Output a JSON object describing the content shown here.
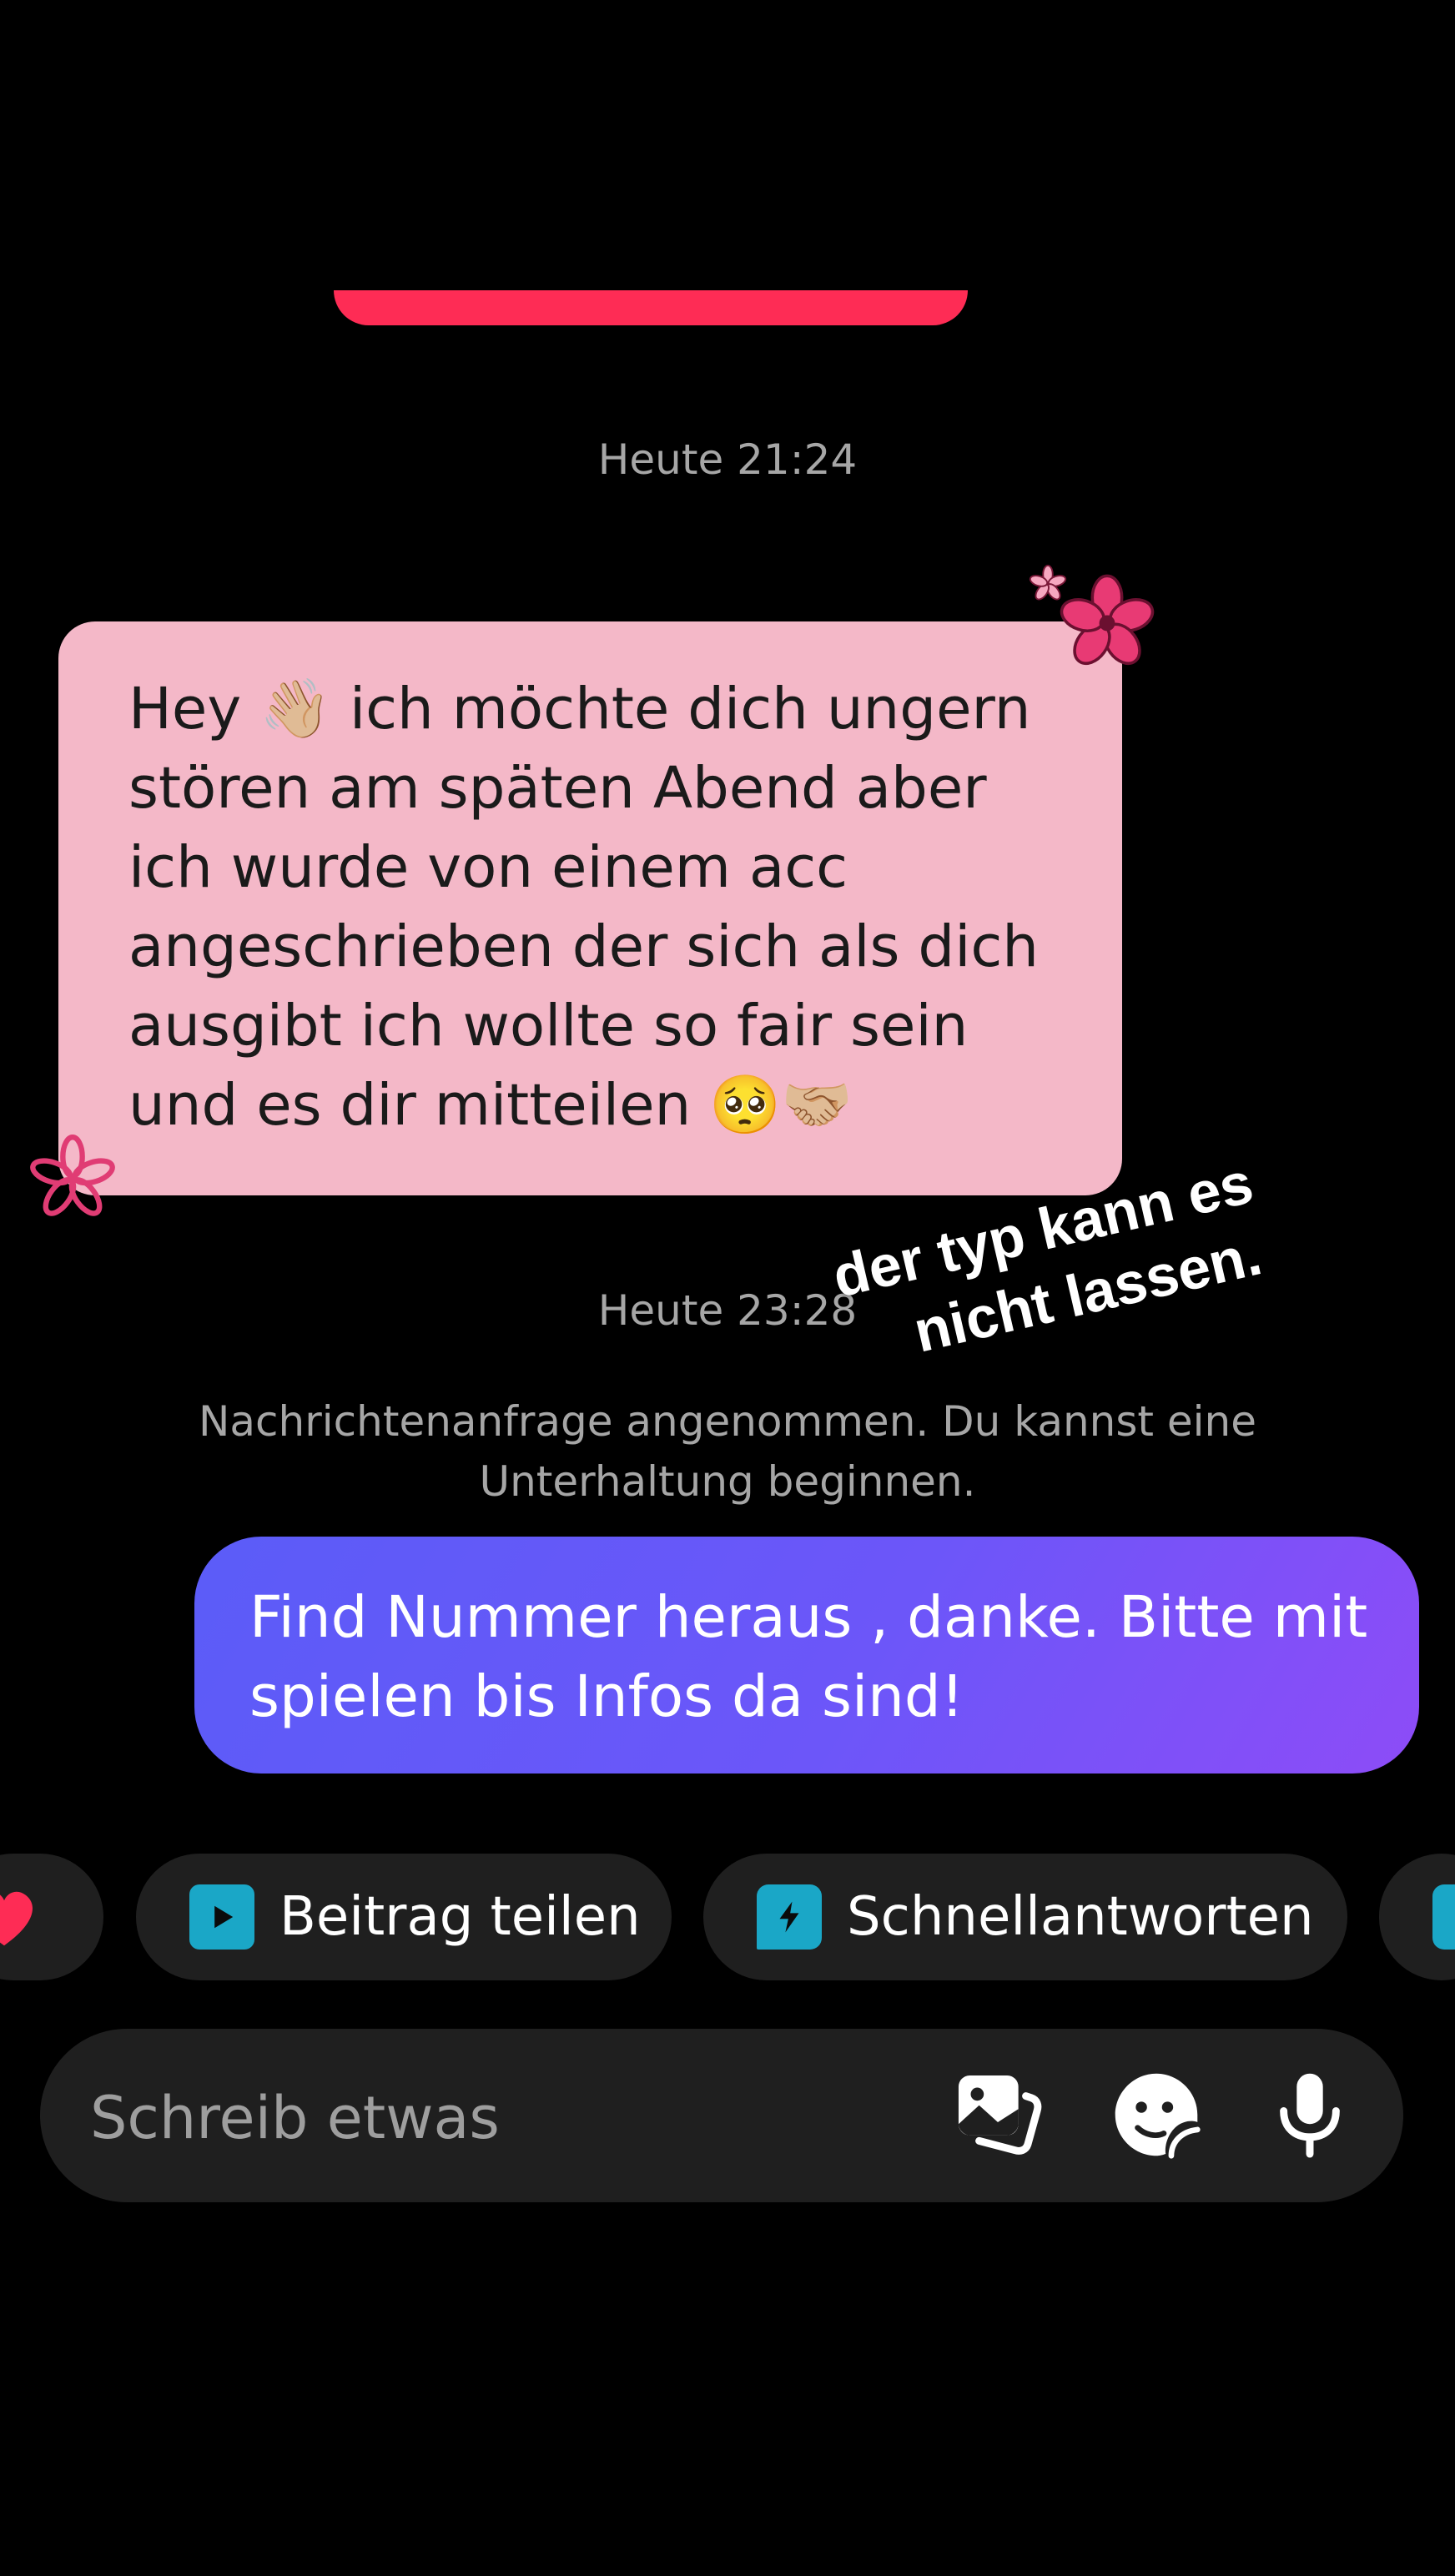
{
  "conversation": {
    "timestamp_1": "Heute 21:24",
    "incoming_message": {
      "lines": [
        "Hey 👋🏼 ich möchte dich ungern",
        "stören am späten Abend aber",
        "ich wurde von einem acc",
        "angeschrieben der sich als dich",
        "ausgibt ich wollte so fair sein",
        "und es dir mitteilen 🥺🤝🏼"
      ]
    },
    "timestamp_2": "Heute 23:28",
    "request_notice": {
      "line1": "Nachrichtenanfrage angenommen. Du kannst eine",
      "line2": "Unterhaltung beginnen."
    },
    "outgoing_message": {
      "lines": [
        "Find Nummer heraus , danke. Bitte mit",
        "spielen bis Infos da sind!"
      ]
    }
  },
  "overlay_caption": {
    "line1": "der typ kann es",
    "line2": "nicht lassen."
  },
  "quick_actions": [
    {
      "label": "",
      "icon": "heart-icon"
    },
    {
      "label": "Beitrag teilen",
      "icon": "play-video-icon"
    },
    {
      "label": "Schnellantworten",
      "icon": "lightning-chat-icon"
    },
    {
      "label": "",
      "icon": "chat-icon"
    }
  ],
  "composer": {
    "placeholder": "Schreib etwas",
    "icons": [
      "image-gallery-icon",
      "sticker-icon",
      "microphone-icon"
    ]
  },
  "colors": {
    "background": "#000000",
    "accent_red": "#fe2c55",
    "incoming_bubble": "#f4b8c8",
    "outgoing_gradient_start": "#5b5cf8",
    "outgoing_gradient_end": "#8d4cf7",
    "chip_icon": "#1aa7c7"
  }
}
